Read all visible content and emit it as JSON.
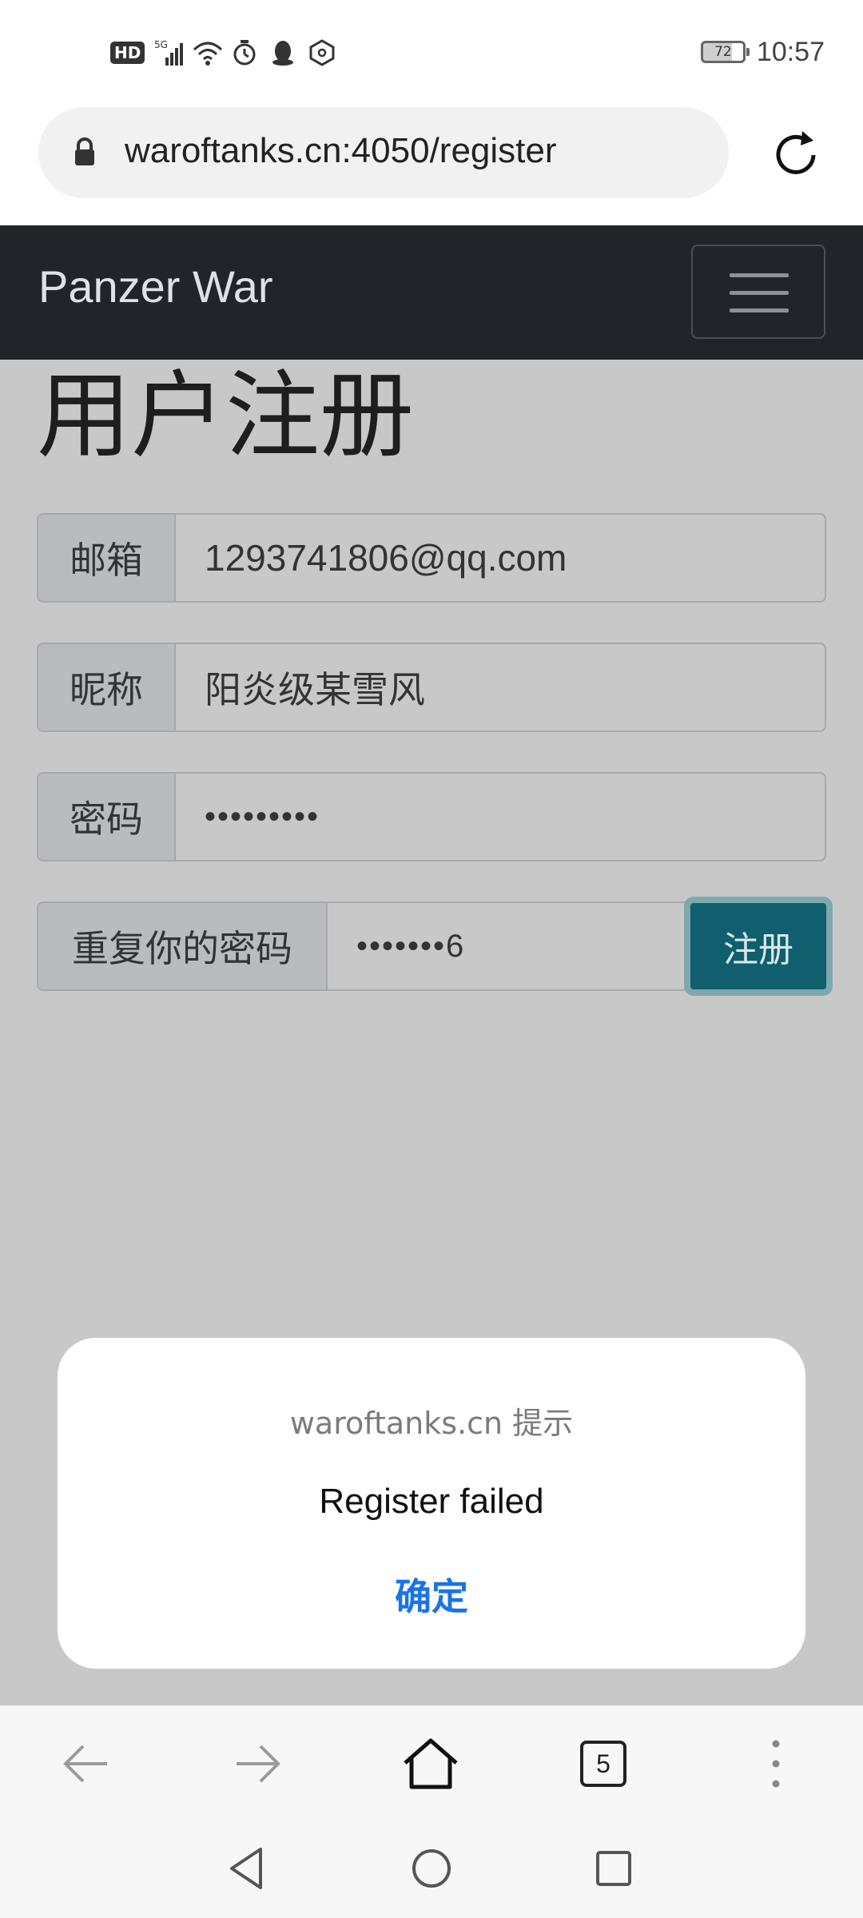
{
  "status_bar": {
    "hd": "HD",
    "network": "5G",
    "battery": "72",
    "time": "10:57"
  },
  "browser": {
    "url": "waroftanks.cn:4050/register",
    "tabs_count": "5"
  },
  "navbar": {
    "brand": "Panzer War"
  },
  "page": {
    "title": "用户注册",
    "fields": [
      {
        "label": "邮箱",
        "value": "1293741806@qq.com"
      },
      {
        "label": "昵称",
        "value": "阳炎级某雪风"
      },
      {
        "label": "密码",
        "value": "•••••••••"
      },
      {
        "label": "重复你的密码",
        "value": "•••••••6"
      }
    ],
    "submit_label": "注册"
  },
  "dialog": {
    "title": "waroftanks.cn 提示",
    "message": "Register failed",
    "ok_label": "确定"
  },
  "colors": {
    "navbar_bg": "#212529",
    "submit_bg": "#0f5f6e",
    "dialog_button": "#1a73e8"
  }
}
